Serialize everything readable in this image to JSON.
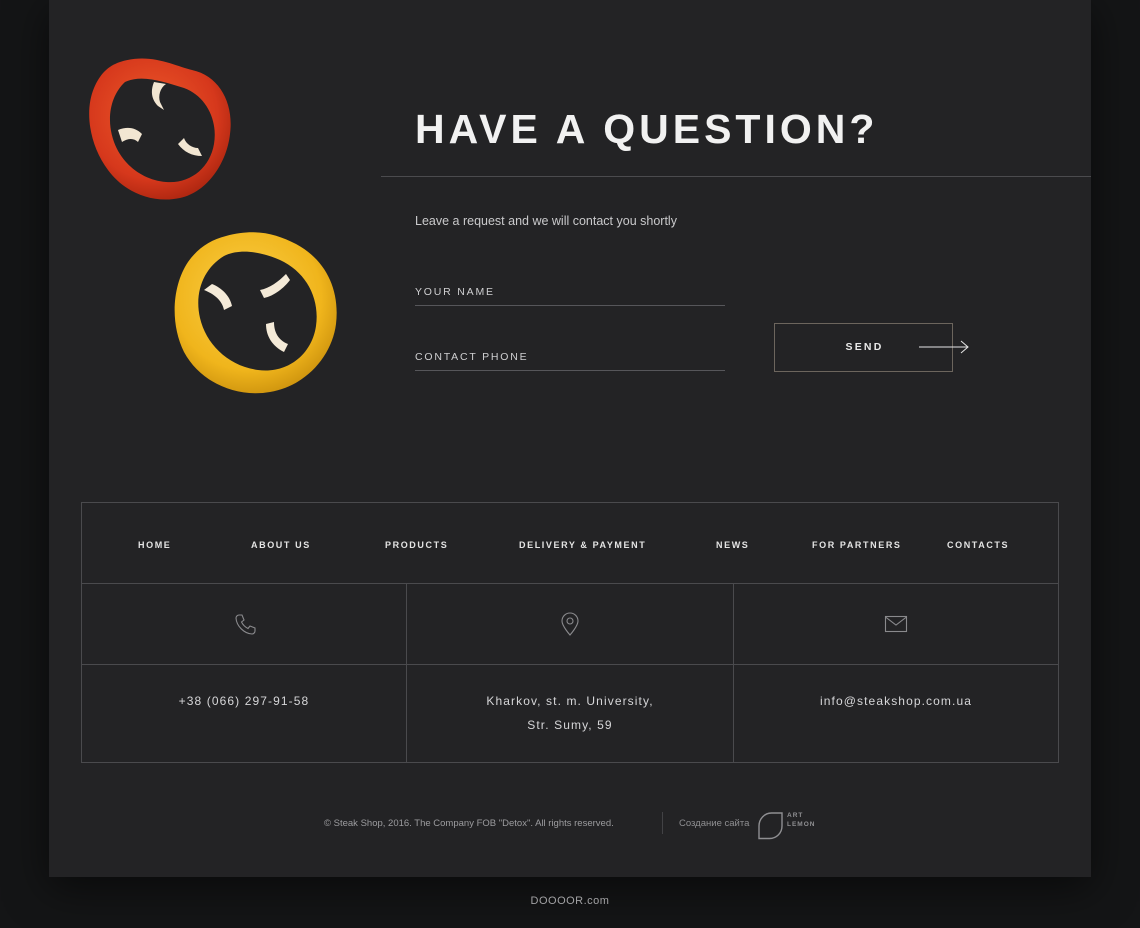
{
  "contact_form": {
    "title": "HAVE A QUESTION?",
    "lead": "Leave a request and we will contact you shortly",
    "name_placeholder": "YOUR NAME",
    "phone_placeholder": "CONTACT PHONE",
    "send_label": "SEND"
  },
  "footer": {
    "nav": [
      {
        "label": "HOME"
      },
      {
        "label": "ABOUT US"
      },
      {
        "label": "PRODUCTS"
      },
      {
        "label": "DELIVERY & PAYMENT"
      },
      {
        "label": "NEWS"
      },
      {
        "label": "FOR PARTNERS"
      },
      {
        "label": "CONTACTS"
      }
    ],
    "contacts": {
      "phone": "+38 (066) 297-91-58",
      "address_line1": "Kharkov, st. m. University,",
      "address_line2": "Str. Sumy, 59",
      "email": "info@steakshop.com.ua"
    },
    "icons": {
      "phone": "phone-icon",
      "location": "location-pin-icon",
      "email": "envelope-icon"
    },
    "copyright": "© Steak Shop, 2016. The Company FOB \"Detox\". All rights reserved.",
    "made_by_label": "Создание сайта",
    "developer_line1": "ART",
    "developer_line2": "LEMON"
  },
  "watermark": "DOOOOR.com",
  "colors": {
    "page_bg": "#141516",
    "card_bg": "#232325",
    "red_pepper": "#d6381c",
    "yellow_pepper": "#f0b51c",
    "button_border": "#6c655d"
  }
}
